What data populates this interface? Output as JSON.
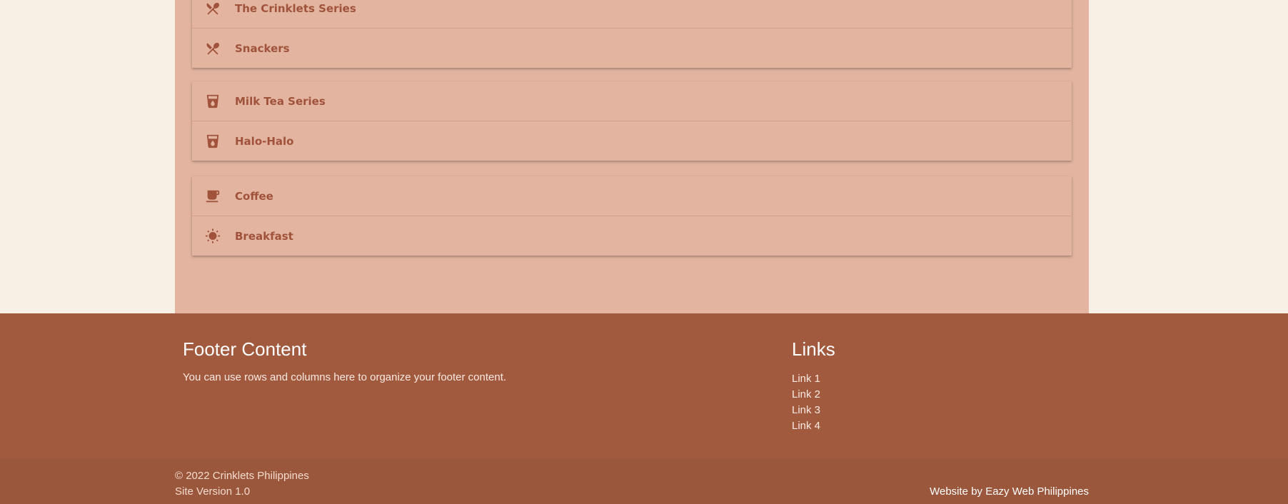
{
  "menu": {
    "groups": [
      {
        "items": [
          {
            "label": "The Crinklets Series",
            "icon": "restaurant-icon"
          },
          {
            "label": "Snackers",
            "icon": "restaurant-icon"
          }
        ]
      },
      {
        "items": [
          {
            "label": "Milk Tea Series",
            "icon": "local-drink-icon"
          },
          {
            "label": "Halo-Halo",
            "icon": "local-drink-icon"
          }
        ]
      },
      {
        "items": [
          {
            "label": "Coffee",
            "icon": "coffee-cup-icon"
          },
          {
            "label": "Breakfast",
            "icon": "sun-icon"
          }
        ]
      }
    ]
  },
  "footer": {
    "content_title": "Footer Content",
    "content_text": "You can use rows and columns here to organize your footer content.",
    "links_title": "Links",
    "links": [
      "Link 1",
      "Link 2",
      "Link 3",
      "Link 4"
    ]
  },
  "copyright": {
    "line1": "© 2022 Crinklets Philippines",
    "line2": "Site Version 1.0",
    "credit": "Website by Eazy Web Philippines"
  },
  "colors": {
    "page_bg": "#f8f0e4",
    "menu_bg": "#e3b5a0",
    "accent": "#a0533a",
    "footer_bg": "#a15a3e",
    "copyright_bg": "#9a573c"
  }
}
